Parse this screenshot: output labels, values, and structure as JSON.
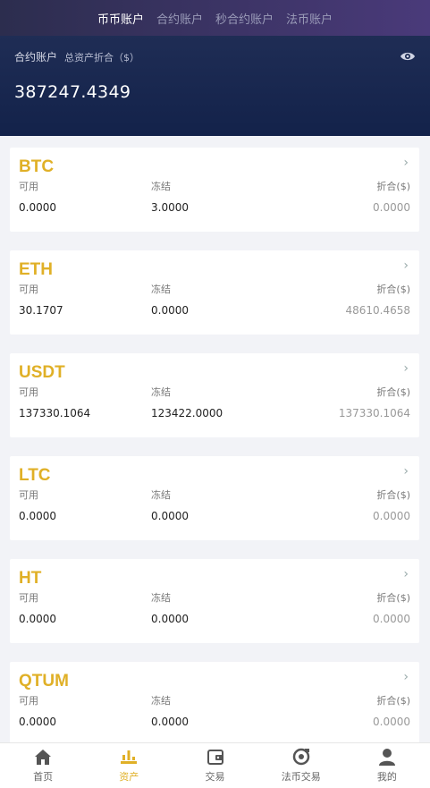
{
  "top_tabs": [
    "币币账户",
    "合约账户",
    "秒合约账户",
    "法币账户"
  ],
  "header": {
    "account_label": "合约账户",
    "total_label": "总资产折合（$）",
    "balance": "387247.4349"
  },
  "labels": {
    "available": "可用",
    "frozen": "冻结",
    "converted": "折合($)"
  },
  "assets": [
    {
      "symbol": "BTC",
      "available": "0.0000",
      "frozen": "3.0000",
      "converted": "0.0000"
    },
    {
      "symbol": "ETH",
      "available": "30.1707",
      "frozen": "0.0000",
      "converted": "48610.4658"
    },
    {
      "symbol": "USDT",
      "available": "137330.1064",
      "frozen": "123422.0000",
      "converted": "137330.1064"
    },
    {
      "symbol": "LTC",
      "available": "0.0000",
      "frozen": "0.0000",
      "converted": "0.0000"
    },
    {
      "symbol": "HT",
      "available": "0.0000",
      "frozen": "0.0000",
      "converted": "0.0000"
    },
    {
      "symbol": "QTUM",
      "available": "0.0000",
      "frozen": "0.0000",
      "converted": "0.0000"
    }
  ],
  "bottom_nav": [
    {
      "label": "首页",
      "icon": "home-icon"
    },
    {
      "label": "资产",
      "icon": "assets-icon"
    },
    {
      "label": "交易",
      "icon": "trade-icon"
    },
    {
      "label": "法币交易",
      "icon": "fiat-icon"
    },
    {
      "label": "我的",
      "icon": "user-icon"
    }
  ],
  "colors": {
    "accent": "#e0b027",
    "header_bg": "#13224a"
  }
}
